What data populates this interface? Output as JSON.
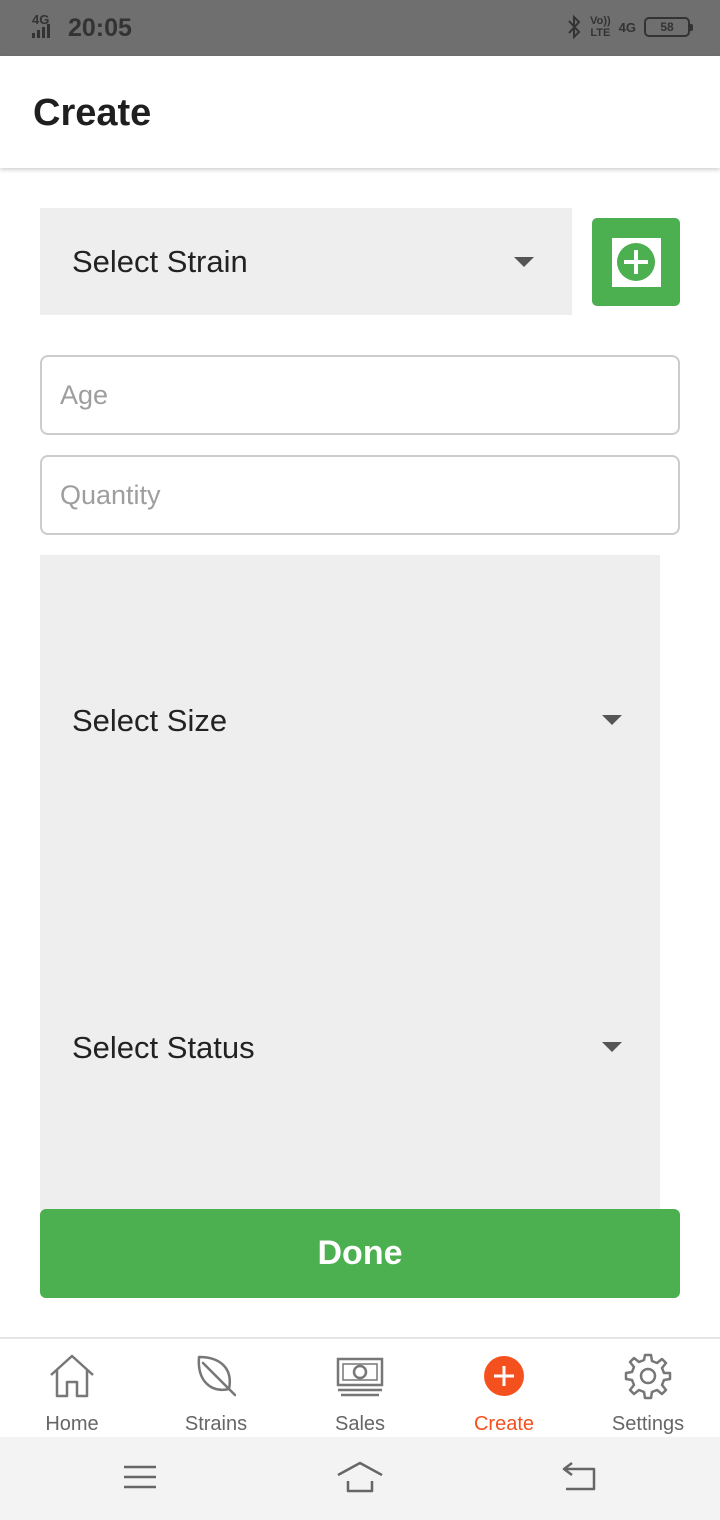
{
  "status_bar": {
    "network": "4G",
    "time": "20:05",
    "volte_top": "Vo))",
    "volte_bottom": "LTE",
    "network_right": "4G",
    "battery": "58"
  },
  "header": {
    "title": "Create"
  },
  "form": {
    "strain_select": {
      "label": "Select Strain"
    },
    "add_strain_icon": "plus-circle-icon",
    "age": {
      "placeholder": "Age",
      "value": ""
    },
    "quantity": {
      "placeholder": "Quantity",
      "value": ""
    },
    "size_select": {
      "label": "Select Size"
    },
    "status_select": {
      "label": "Select Status"
    },
    "done_label": "Done"
  },
  "bottom_nav": {
    "items": [
      {
        "label": "Home",
        "icon": "home-icon"
      },
      {
        "label": "Strains",
        "icon": "leaf-icon"
      },
      {
        "label": "Sales",
        "icon": "cash-icon"
      },
      {
        "label": "Create",
        "icon": "add-circle-icon",
        "active": true
      },
      {
        "label": "Settings",
        "icon": "gear-icon"
      }
    ]
  },
  "colors": {
    "accent_green": "#4caf50",
    "active_orange": "#f4511e",
    "field_gray": "#eeeeee"
  }
}
